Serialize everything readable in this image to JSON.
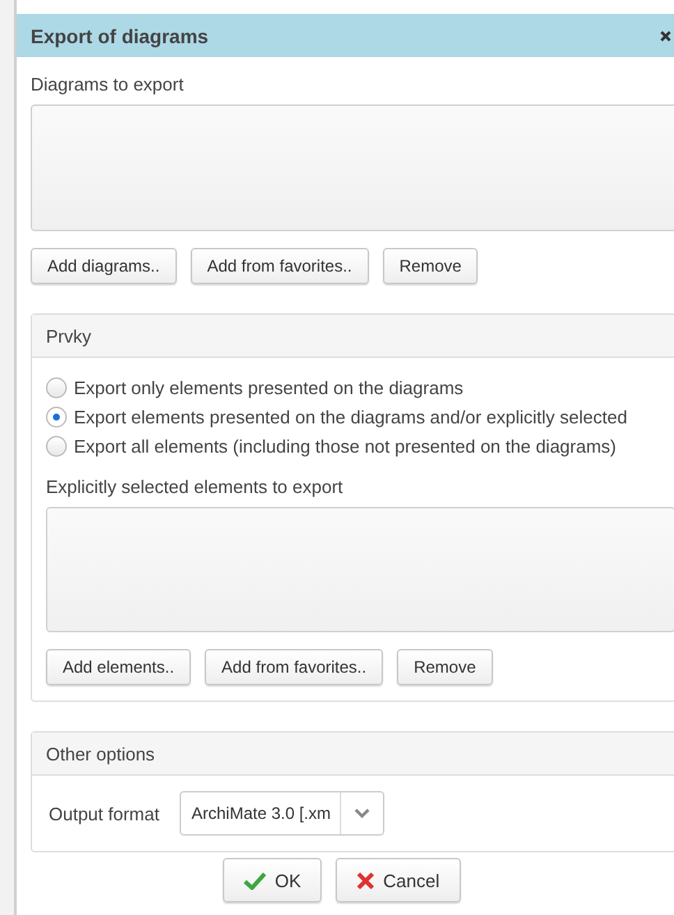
{
  "dialog": {
    "title": "Export of diagrams"
  },
  "diagrams": {
    "label": "Diagrams to export",
    "buttons": [
      "Add diagrams..",
      "Add from favorites..",
      "Remove"
    ]
  },
  "elements_panel": {
    "title": "Prvky",
    "options": [
      {
        "label": "Export only elements presented on the diagrams",
        "selected": false
      },
      {
        "label": "Export elements presented on the diagrams and/or explicitly selected",
        "selected": true
      },
      {
        "label": "Export all elements (including those not presented on the diagrams)",
        "selected": false
      }
    ],
    "list_label": "Explicitly selected elements to export",
    "buttons": [
      "Add elements..",
      "Add from favorites..",
      "Remove"
    ]
  },
  "other_options": {
    "title": "Other options",
    "output_format_label": "Output format",
    "output_format_value": "ArchiMate 3.0 [.xm"
  },
  "footer_buttons": [
    {
      "label": "OK",
      "kind": "ok"
    },
    {
      "label": "Cancel",
      "kind": "cancel"
    }
  ]
}
